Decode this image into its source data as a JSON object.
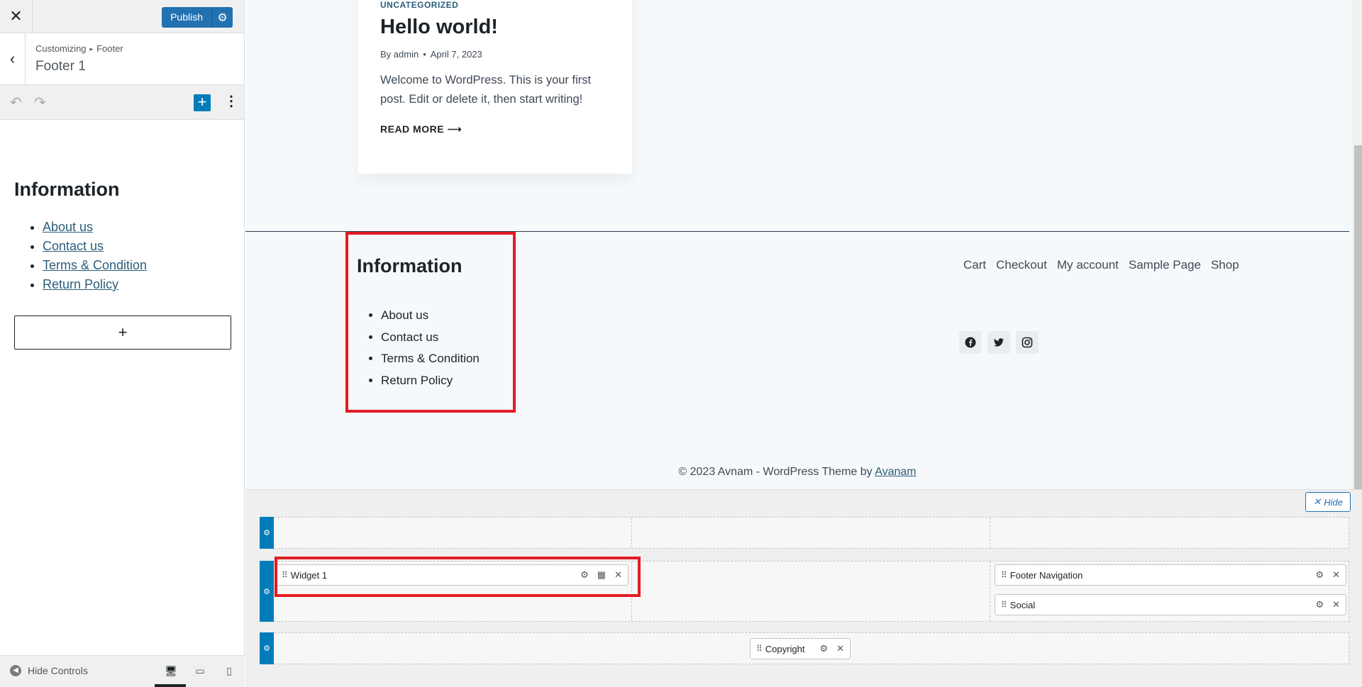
{
  "sidebar": {
    "close_glyph": "✕",
    "publish_label": "Publish",
    "breadcrumb_root": "Customizing",
    "breadcrumb_sep": "▸",
    "breadcrumb_section": "Footer",
    "panel_title": "Footer 1",
    "widget_heading": "Information",
    "widget_links": [
      "About us",
      "Contact us",
      "Terms & Condition",
      "Return Policy"
    ],
    "appender_glyph": "+",
    "hide_controls_label": "Hide Controls"
  },
  "preview": {
    "post": {
      "category": "UNCATEGORIZED",
      "title": "Hello world!",
      "author": "By admin",
      "date": "April 7, 2023",
      "excerpt": "Welcome to WordPress. This is your first post. Edit or delete it, then start writing!",
      "read_more": "READ MORE ⟶"
    },
    "footer": {
      "heading": "Information",
      "links": [
        "About us",
        "Contact us",
        "Terms & Condition",
        "Return Policy"
      ],
      "nav": [
        "Cart",
        "Checkout",
        "My account",
        "Sample Page",
        "Shop"
      ],
      "social": [
        "facebook-icon",
        "twitter-icon",
        "instagram-icon"
      ],
      "copyright_text": "© 2023 Avnam - WordPress Theme by ",
      "copyright_link": "Avanam"
    }
  },
  "builder": {
    "hide_label": "Hide",
    "items": {
      "widget1": "Widget 1",
      "footer_navigation": "Footer Navigation",
      "social": "Social",
      "copyright": "Copyright"
    }
  },
  "colors": {
    "accent": "#2271b1",
    "builder_handle": "#007cba",
    "highlight": "#e31b23"
  }
}
